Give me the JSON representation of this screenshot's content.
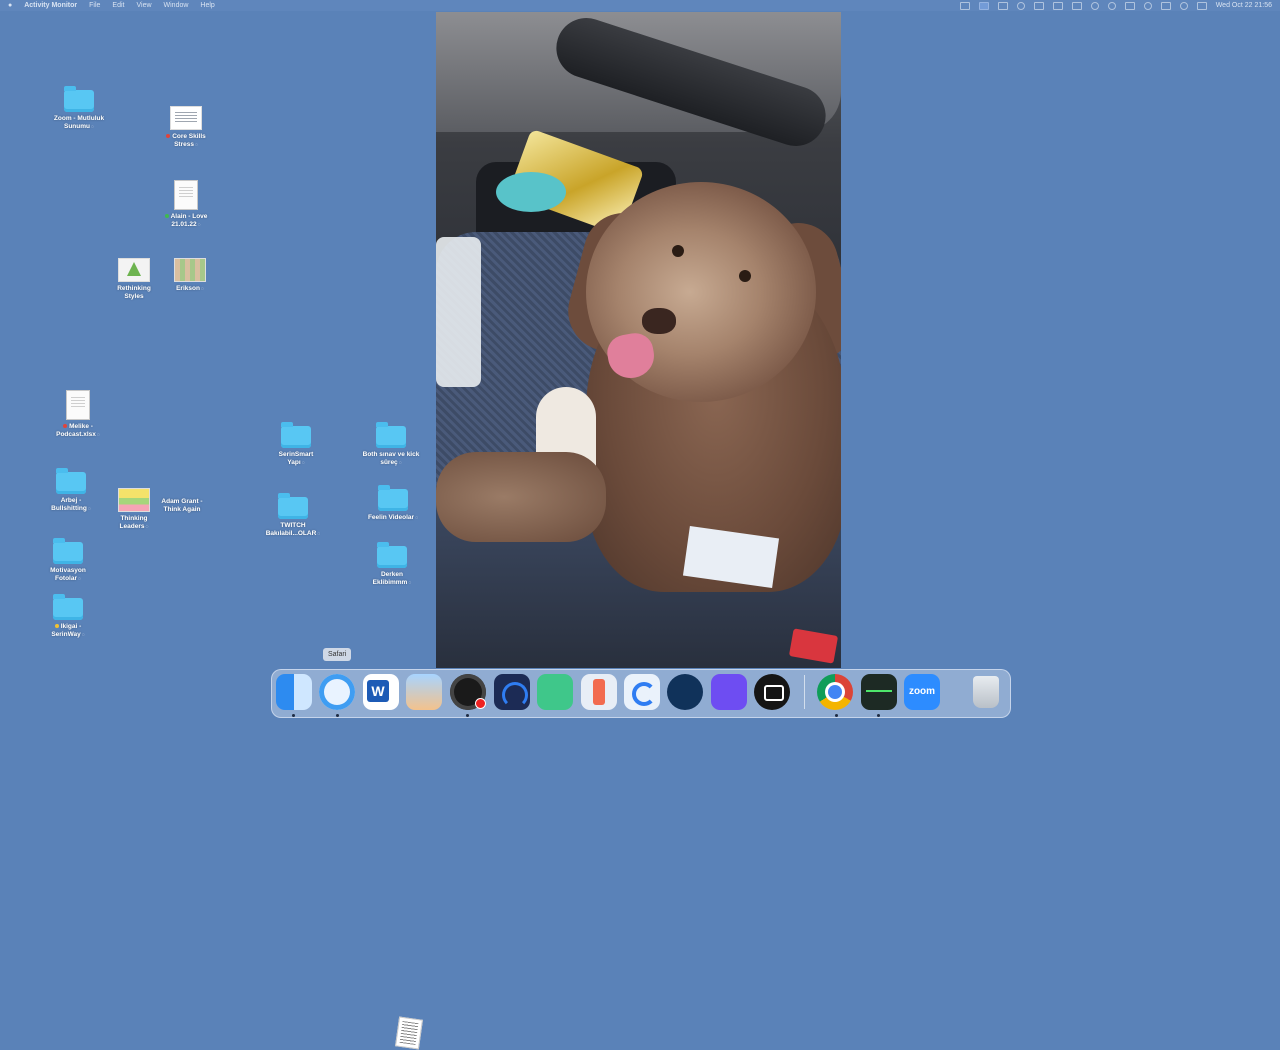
{
  "menubar": {
    "app": "Activity Monitor",
    "items": [
      "File",
      "Edit",
      "View",
      "Window",
      "Help"
    ],
    "clock": "Wed Oct 22  21:56"
  },
  "desktop": {
    "icons": [
      {
        "name": "Zoom - Mutluluk Sunumu",
        "lines": [
          "Zoom - Mutluluk",
          "Sunumu"
        ],
        "kind": "folder"
      },
      {
        "name": "Core Skills Stress",
        "lines": [
          "Core Skills",
          "Stress"
        ],
        "kind": "slide",
        "tag": "#e0443c"
      },
      {
        "name": "Alain - Love 21.01.22",
        "lines": [
          "Alain - Love",
          "21.01.22"
        ],
        "kind": "doc",
        "tag": "#3fb950"
      },
      {
        "name": "Rethinking Styles",
        "lines": [
          "Rethinking",
          "Styles"
        ],
        "kind": "pyr"
      },
      {
        "name": "Erikson",
        "lines": [
          "Erikson"
        ],
        "kind": "grid"
      },
      {
        "name": "Melike - Podcast.xlsx",
        "lines": [
          "Melike -",
          "Podcast.xlsx"
        ],
        "kind": "doc",
        "tag": "#e0443c"
      },
      {
        "name": "Arbej - Bullshitting",
        "lines": [
          "Arbej -",
          "Bullshitting"
        ],
        "kind": "folder"
      },
      {
        "name": "Thinking Leaders",
        "lines": [
          "Thinking",
          "Leaders"
        ],
        "kind": "sticky"
      },
      {
        "name": "Adam Grant - Think Again",
        "lines": [
          "Adam Grant -",
          "Think Again"
        ],
        "kind": "paper"
      },
      {
        "name": "Motivasyon Fotolar",
        "lines": [
          "Motivasyon",
          "Fotolar"
        ],
        "kind": "folder"
      },
      {
        "name": "Ikigai - SerinWay",
        "lines": [
          "Ikigai -",
          "SerinWay"
        ],
        "kind": "folder",
        "tag": "#f2c230"
      },
      {
        "name": "SerinSmart Yapı",
        "lines": [
          "SerinSmart",
          "Yapı"
        ],
        "kind": "folder"
      },
      {
        "name": "TWITCH Bakılabil...OLAR",
        "lines": [
          "TWITCH",
          "Bakılabil...OLAR"
        ],
        "kind": "folder"
      },
      {
        "name": "Both sınav ve kick süreç",
        "lines": [
          "Both sınav ve kick",
          "süreç"
        ],
        "kind": "folder"
      },
      {
        "name": "Feelin Videolar",
        "lines": [
          "Feelin Videolar"
        ],
        "kind": "folder"
      },
      {
        "name": "Derken Eklibimmm",
        "lines": [
          "Derken",
          "Eklibimmm"
        ],
        "kind": "folder"
      }
    ]
  },
  "dock": {
    "tooltip": "Safari",
    "apps": [
      "finder-icon",
      "safari-icon",
      "word-icon",
      "character-icon",
      "obs-icon",
      "audio-icon",
      "green-app-icon",
      "phone-mirror-icon",
      "c-app-icon",
      "steam-icon",
      "purple-app-icon",
      "camera-app-icon",
      "chrome-icon",
      "activity-monitor-icon",
      "zoom-icon",
      "trash-icon"
    ],
    "zoom_label": "zoom"
  },
  "colors": {
    "desktop": "#5a82b8",
    "folder": "#58c7f3"
  }
}
